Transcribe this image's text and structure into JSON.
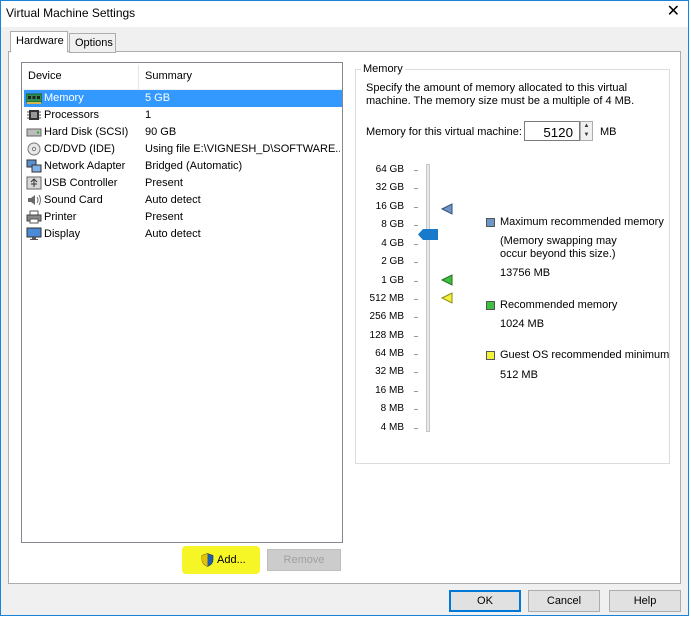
{
  "window": {
    "title": "Virtual Machine Settings"
  },
  "tabs": [
    {
      "label": "Hardware"
    },
    {
      "label": "Options"
    }
  ],
  "device_list": {
    "col_device": "Device",
    "col_summary": "Summary",
    "items": [
      {
        "name": "Memory",
        "summary": "5 GB",
        "icon": "memory-icon"
      },
      {
        "name": "Processors",
        "summary": "1",
        "icon": "processor-icon"
      },
      {
        "name": "Hard Disk (SCSI)",
        "summary": "90 GB",
        "icon": "hard-disk-icon"
      },
      {
        "name": "CD/DVD (IDE)",
        "summary": "Using file E:\\VIGNESH_D\\SOFTWARE...",
        "icon": "cd-dvd-icon"
      },
      {
        "name": "Network Adapter",
        "summary": "Bridged (Automatic)",
        "icon": "network-adapter-icon"
      },
      {
        "name": "USB Controller",
        "summary": "Present",
        "icon": "usb-icon"
      },
      {
        "name": "Sound Card",
        "summary": "Auto detect",
        "icon": "sound-card-icon"
      },
      {
        "name": "Printer",
        "summary": "Present",
        "icon": "printer-icon"
      },
      {
        "name": "Display",
        "summary": "Auto detect",
        "icon": "display-icon"
      }
    ],
    "selected": "Memory"
  },
  "buttons": {
    "add": "Add...",
    "remove": "Remove",
    "ok": "OK",
    "cancel": "Cancel",
    "help": "Help"
  },
  "memory": {
    "group_title": "Memory",
    "description": "Specify the amount of memory allocated to this virtual machine. The memory size must be a multiple of 4 MB.",
    "field_label": "Memory for this virtual machine:",
    "value": "5120",
    "unit": "MB",
    "scale": [
      "64 GB",
      "32 GB",
      "16 GB",
      "8 GB",
      "4 GB",
      "2 GB",
      "1 GB",
      "512 MB",
      "256 MB",
      "128 MB",
      "64 MB",
      "32 MB",
      "16 MB",
      "8 MB",
      "4 MB"
    ],
    "legend": {
      "max_label": "Maximum recommended memory",
      "max_note": "(Memory swapping may occur beyond this size.)",
      "max_value": "13756 MB",
      "rec_label": "Recommended memory",
      "rec_value": "1024 MB",
      "min_label": "Guest OS recommended minimum",
      "min_value": "512 MB"
    },
    "colors": {
      "max": "#6d95c6",
      "recommended": "#3fbf3f",
      "minimum": "#f2f23a",
      "thumb": "#1979ca"
    }
  }
}
